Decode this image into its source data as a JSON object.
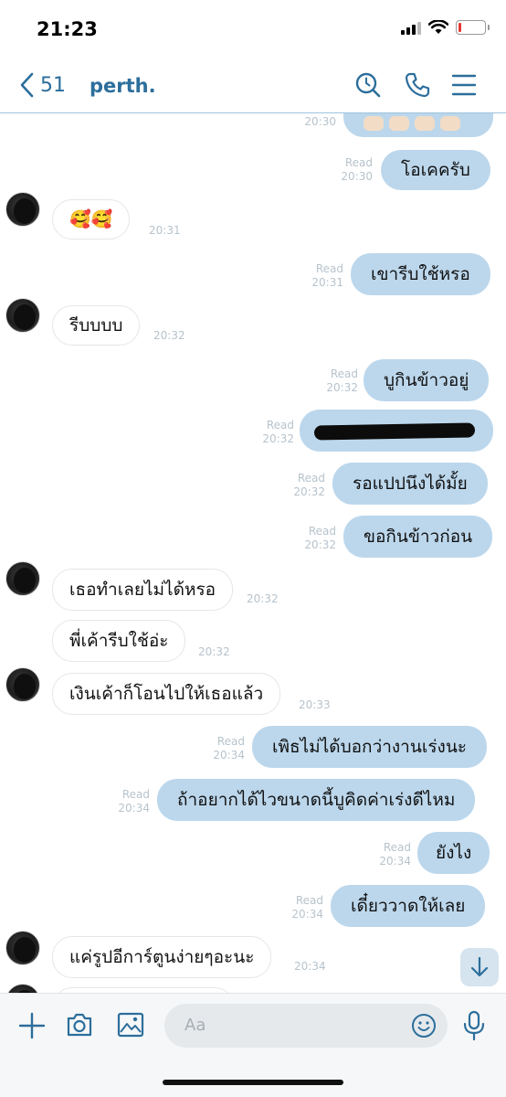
{
  "status_bar": {
    "time": "21:23"
  },
  "header": {
    "back_count": "51",
    "title": "perth."
  },
  "messages": [
    {
      "dir": "out",
      "kind": "sticker",
      "text": "",
      "read": "Read",
      "time": "20:30"
    },
    {
      "dir": "out",
      "text": "โอเคครับ",
      "read": "Read",
      "time": "20:30"
    },
    {
      "dir": "in",
      "text": "🥰🥰",
      "time": "20:31"
    },
    {
      "dir": "out",
      "text": "เขารีบใช้หรอ",
      "read": "Read",
      "time": "20:31"
    },
    {
      "dir": "in",
      "text": "รีบบบบ",
      "time": "20:32"
    },
    {
      "dir": "out",
      "text": "บูกินข้าวอยู่",
      "read": "Read",
      "time": "20:32"
    },
    {
      "dir": "out",
      "text": "",
      "redacted": true,
      "read": "Read",
      "time": "20:32"
    },
    {
      "dir": "out",
      "text": "รอแปปนึงได้มั้ย",
      "read": "Read",
      "time": "20:32"
    },
    {
      "dir": "out",
      "text": "ขอกินข้าวก่อน",
      "read": "Read",
      "time": "20:32"
    },
    {
      "dir": "in",
      "text": "เธอทำเลยไม่ได้หรอ",
      "time": "20:32"
    },
    {
      "dir": "in",
      "text": "พี่เค้ารีบใช้อ่ะ",
      "time": "20:32"
    },
    {
      "dir": "in",
      "text": "เงินเค้าก็โอนไปให้เธอแล้ว",
      "time": "20:33"
    },
    {
      "dir": "out",
      "text": "เพิธไม่ได้บอกว่างานเร่งนะ",
      "read": "Read",
      "time": "20:34"
    },
    {
      "dir": "out",
      "text": "ถ้าอยากได้ไวขนาดนี้บูคิดค่าเร่งดีไหม",
      "read": "Read",
      "time": "20:34"
    },
    {
      "dir": "out",
      "text": "ยังไง",
      "read": "Read",
      "time": "20:34"
    },
    {
      "dir": "out",
      "text": "เดี๋ยววาดให้เลย",
      "read": "Read",
      "time": "20:34"
    },
    {
      "dir": "in",
      "text": "แค่รูปอีการ์ตูนง่ายๆอะนะ",
      "time": "20:34"
    }
  ],
  "input": {
    "placeholder": "Aa"
  },
  "colors": {
    "accent": "#2c6e9c",
    "outgoing_bubble": "#bcd7ec",
    "divider": "#9ec4dd"
  },
  "icons": [
    "chevron-left-icon",
    "search-icon",
    "phone-icon",
    "menu-icon",
    "plus-icon",
    "camera-icon",
    "image-icon",
    "emoji-icon",
    "microphone-icon",
    "arrow-down-icon"
  ]
}
